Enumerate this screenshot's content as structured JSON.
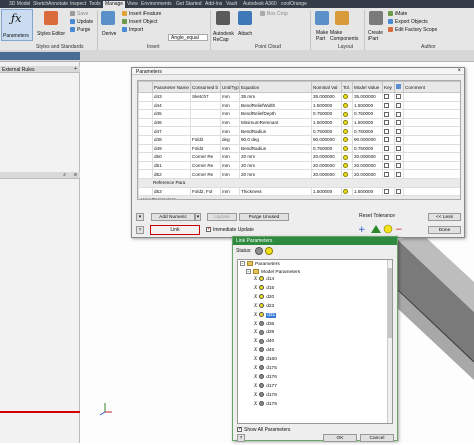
{
  "ribbon": {
    "tabs": [
      "3D Model",
      "Sketch",
      "Annotate",
      "Inspect",
      "Tools",
      "Manage",
      "View",
      "Environments",
      "Get Started",
      "Add-Ins",
      "Vault",
      "Autodesk A360",
      "coolOrange"
    ],
    "active_tab": "Manage",
    "parameters_label": "Parameters",
    "styles_editor_label": "Styles Editor",
    "save_label": "Save",
    "update_label": "Update",
    "purge_label": "Purge",
    "derive_label": "Derive",
    "insert_ifeature_label": "Insert iFeature",
    "insert_object_label": "Insert Object",
    "import_label": "Import",
    "angle_equal_label": "Angle_equal",
    "autodesk_recap_label": "Autodesk ReCap",
    "attach_label": "Attach",
    "bbox_crop_label": "Box Crop",
    "make_part_label": "Make Part",
    "make_components_label": "Make Components",
    "create_ipart_label": "Create iPart",
    "imate_label": "iMate",
    "export_objects_label": "Export Objects",
    "edit_factory_scope_label": "Edit Factory Scope",
    "group_styles": "Styles and Standards",
    "group_insert": "Insert",
    "group_pointcloud": "Point Cloud",
    "group_layout": "Layout",
    "group_author": "Author"
  },
  "left_panel": {
    "external_rules_label": "External Rules"
  },
  "params_dialog": {
    "title": "Parameters",
    "columns": [
      "Parameter Name",
      "Consumed b",
      "Unit/Typ",
      "Equation",
      "Nominal Val",
      "Tol.",
      "Model Value",
      "Key",
      "",
      "Comment"
    ],
    "rows": [
      {
        "name": "d43",
        "consumed": "Sketch7",
        "unit": "mm",
        "equation": "35 mm",
        "nominal": "35.000000",
        "model": "35.000000"
      },
      {
        "name": "d44",
        "consumed": "",
        "unit": "mm",
        "equation": "BendReliefWidth",
        "nominal": "1.500000",
        "model": "1.500000"
      },
      {
        "name": "d45",
        "consumed": "",
        "unit": "mm",
        "equation": "BendReliefDepth",
        "nominal": "0.750000",
        "model": "0.750000"
      },
      {
        "name": "d46",
        "consumed": "",
        "unit": "mm",
        "equation": "MinimumRemnant",
        "nominal": "1.500000",
        "model": "1.500000"
      },
      {
        "name": "d47",
        "consumed": "",
        "unit": "mm",
        "equation": "BendRadius",
        "nominal": "0.750000",
        "model": "0.750000"
      },
      {
        "name": "d48",
        "consumed": "Fold2",
        "unit": "deg",
        "equation": "90.0 deg",
        "nominal": "90.000000",
        "model": "90.000000"
      },
      {
        "name": "d49",
        "consumed": "Fold2",
        "unit": "mm",
        "equation": "BendRadius",
        "nominal": "0.750000",
        "model": "0.750000"
      },
      {
        "name": "d50",
        "consumed": "Corner Re",
        "unit": "mm",
        "equation": "20 mm",
        "nominal": "20.000000",
        "model": "20.000000"
      },
      {
        "name": "d51",
        "consumed": "Corner Re",
        "unit": "mm",
        "equation": "20 mm",
        "nominal": "20.000000",
        "model": "20.000000"
      },
      {
        "name": "d52",
        "consumed": "Corner Re",
        "unit": "mm",
        "equation": "20 mm",
        "nominal": "20.000000",
        "model": "20.000000"
      }
    ],
    "group_reference": "Reference Para",
    "ref_rows": [
      {
        "name": "d53",
        "consumed": "Fold2, Fol",
        "unit": "mm",
        "equation": "Thickness",
        "nominal": "1.500000",
        "model": "1.500000"
      }
    ],
    "group_user": "User Parameters",
    "add_numeric_label": "Add Numeric",
    "update_label": "Update",
    "purge_unused_label": "Purge Unused",
    "reset_tolerance_label": "Reset Tolerance",
    "less_label": "<< Less",
    "link_label": "Link",
    "immediate_update_label": "Immediate Update",
    "done_label": "Done"
  },
  "link_dialog": {
    "title": "Link Parameters",
    "status_label": "Status:",
    "root_label": "Parameters",
    "group_label": "Model Parameters",
    "items": [
      {
        "name": "d14",
        "color": "#f2e21a"
      },
      {
        "name": "d15",
        "color": "#f2e21a"
      },
      {
        "name": "d20",
        "color": "#f2e21a"
      },
      {
        "name": "d23",
        "color": "#f2e21a"
      },
      {
        "name": "d31",
        "color": "#f2e21a",
        "selected": true
      },
      {
        "name": "d36",
        "color": "#8c8c8c"
      },
      {
        "name": "d39",
        "color": "#8c8c8c"
      },
      {
        "name": "d40",
        "color": "#8c8c8c"
      },
      {
        "name": "d45",
        "color": "#8c8c8c"
      },
      {
        "name": "d160",
        "color": "#8c8c8c"
      },
      {
        "name": "d175",
        "color": "#8c8c8c"
      },
      {
        "name": "d176",
        "color": "#8c8c8c"
      },
      {
        "name": "d177",
        "color": "#8c8c8c"
      },
      {
        "name": "d178",
        "color": "#8c8c8c"
      },
      {
        "name": "d179",
        "color": "#8c8c8c"
      }
    ],
    "show_all_label": "Show All Parameters",
    "ok_label": "OK",
    "cancel_label": "Cancel"
  },
  "colors": {
    "titlebar_dark": "#333c47",
    "link_title": "#2d8a3e",
    "highlight": "#cc0000"
  }
}
